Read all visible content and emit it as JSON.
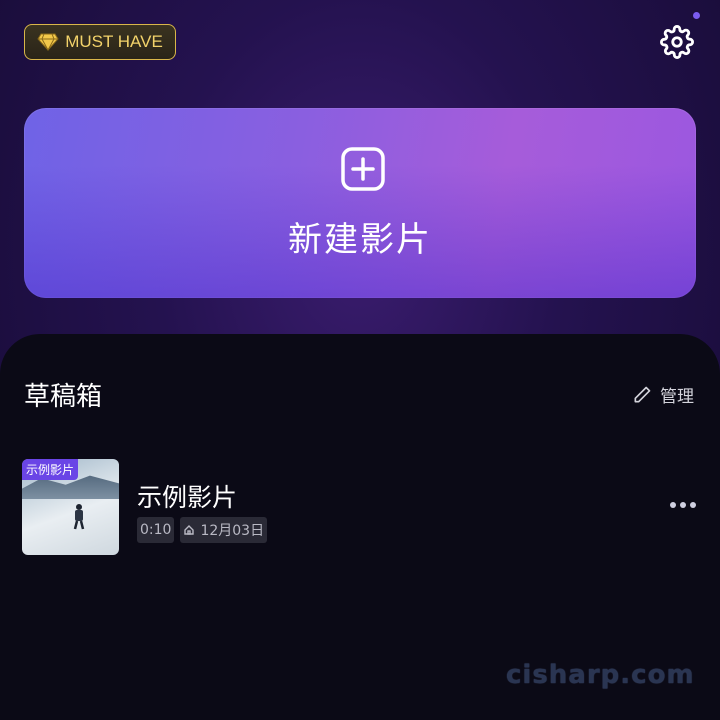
{
  "header": {
    "badge_label": "MUST HAVE",
    "badge_icon": "diamond-icon",
    "settings_icon": "gear-icon",
    "notification_dot_color": "#7b5cf0"
  },
  "new_project": {
    "label": "新建影片",
    "icon": "plus-square-icon"
  },
  "drafts": {
    "title": "草稿箱",
    "manage_label": "管理",
    "manage_icon": "pencil-icon",
    "items": [
      {
        "thumb_tag": "示例影片",
        "title": "示例影片",
        "duration": "0:10",
        "date": "12月03日",
        "more_icon": "more-horizontal-icon"
      }
    ]
  },
  "watermark": "cisharp.com",
  "colors": {
    "accent": "#7b5cf0",
    "badge_gold": "#f2d26a",
    "panel_bg": "#0b0a16"
  }
}
